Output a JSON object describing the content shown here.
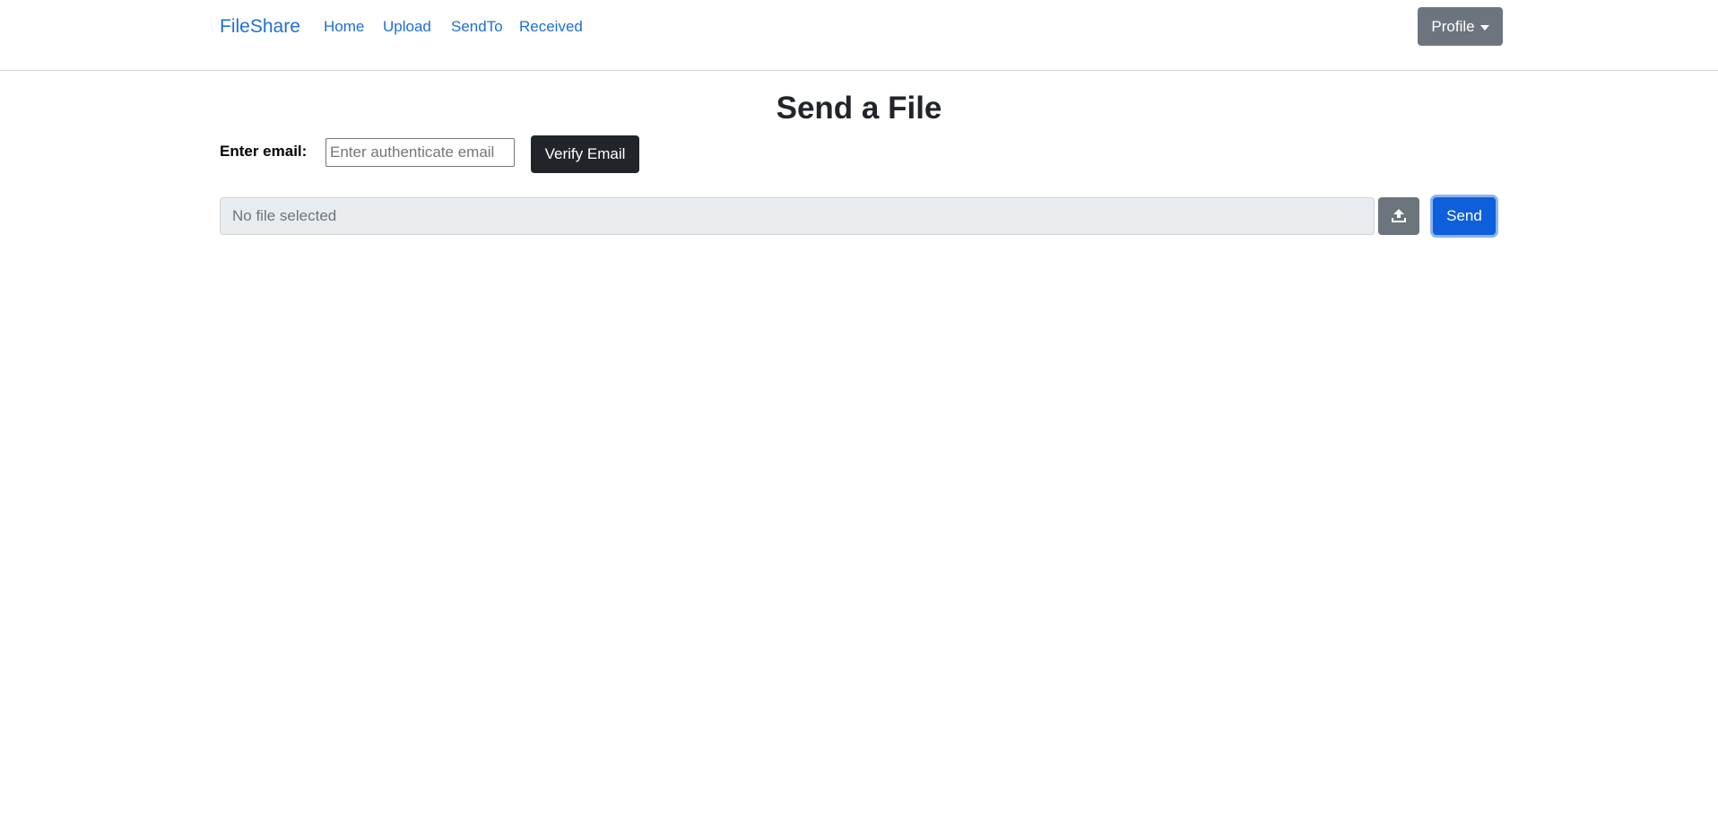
{
  "navbar": {
    "brand": "FileShare",
    "links": [
      {
        "label": "Home"
      },
      {
        "label": "Upload"
      },
      {
        "label": "SendTo"
      },
      {
        "label": "Received"
      }
    ],
    "profile_label": "Profile"
  },
  "main": {
    "title": "Send a File",
    "email_label": "Enter email:",
    "email_placeholder": "Enter authenticate email",
    "email_value": "",
    "verify_label": "Verify Email",
    "file_status": "No file selected",
    "upload_icon": "upload-icon",
    "send_label": "Send"
  },
  "colors": {
    "link": "#1e6fd9",
    "profile_button": "#6c757d",
    "verify_button": "#212529",
    "upload_button": "#6c757d",
    "send_button": "#0d5fdb",
    "file_display_bg": "#e9ecef"
  }
}
